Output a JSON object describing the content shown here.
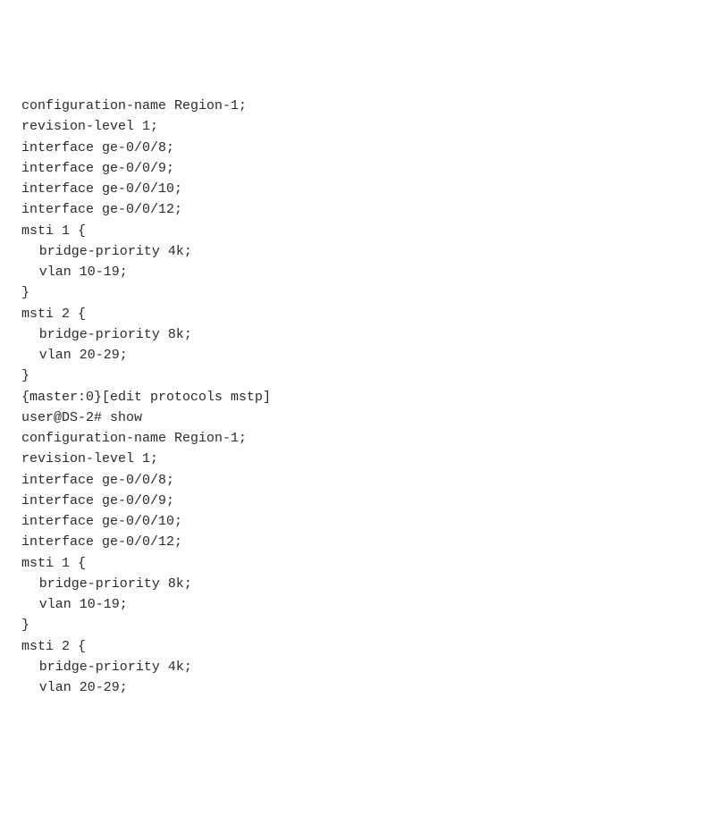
{
  "lines": [
    {
      "text": "configuration-name Region-1;",
      "indent": 0
    },
    {
      "text": "revision-level 1;",
      "indent": 0
    },
    {
      "text": "interface ge-0/0/8;",
      "indent": 0
    },
    {
      "text": "interface ge-0/0/9;",
      "indent": 0
    },
    {
      "text": "interface ge-0/0/10;",
      "indent": 0
    },
    {
      "text": "interface ge-0/0/12;",
      "indent": 0
    },
    {
      "text": "msti 1 {",
      "indent": 0
    },
    {
      "text": "bridge-priority 4k;",
      "indent": 1
    },
    {
      "text": "vlan 10-19;",
      "indent": 1
    },
    {
      "text": "}",
      "indent": 0
    },
    {
      "text": "msti 2 {",
      "indent": 0
    },
    {
      "text": "bridge-priority 8k;",
      "indent": 1
    },
    {
      "text": "vlan 20-29;",
      "indent": 1
    },
    {
      "text": "}",
      "indent": 0
    },
    {
      "text": "{master:0}[edit protocols mstp]",
      "indent": 0
    },
    {
      "text": "user@DS-2# show",
      "indent": 0
    },
    {
      "text": "configuration-name Region-1;",
      "indent": 0
    },
    {
      "text": "revision-level 1;",
      "indent": 0
    },
    {
      "text": "interface ge-0/0/8;",
      "indent": 0
    },
    {
      "text": "interface ge-0/0/9;",
      "indent": 0
    },
    {
      "text": "interface ge-0/0/10;",
      "indent": 0
    },
    {
      "text": "interface ge-0/0/12;",
      "indent": 0
    },
    {
      "text": "msti 1 {",
      "indent": 0
    },
    {
      "text": "bridge-priority 8k;",
      "indent": 1
    },
    {
      "text": "vlan 10-19;",
      "indent": 1
    },
    {
      "text": "}",
      "indent": 0
    },
    {
      "text": "msti 2 {",
      "indent": 0
    },
    {
      "text": "bridge-priority 4k;",
      "indent": 1
    },
    {
      "text": "vlan 20-29;",
      "indent": 1
    }
  ]
}
